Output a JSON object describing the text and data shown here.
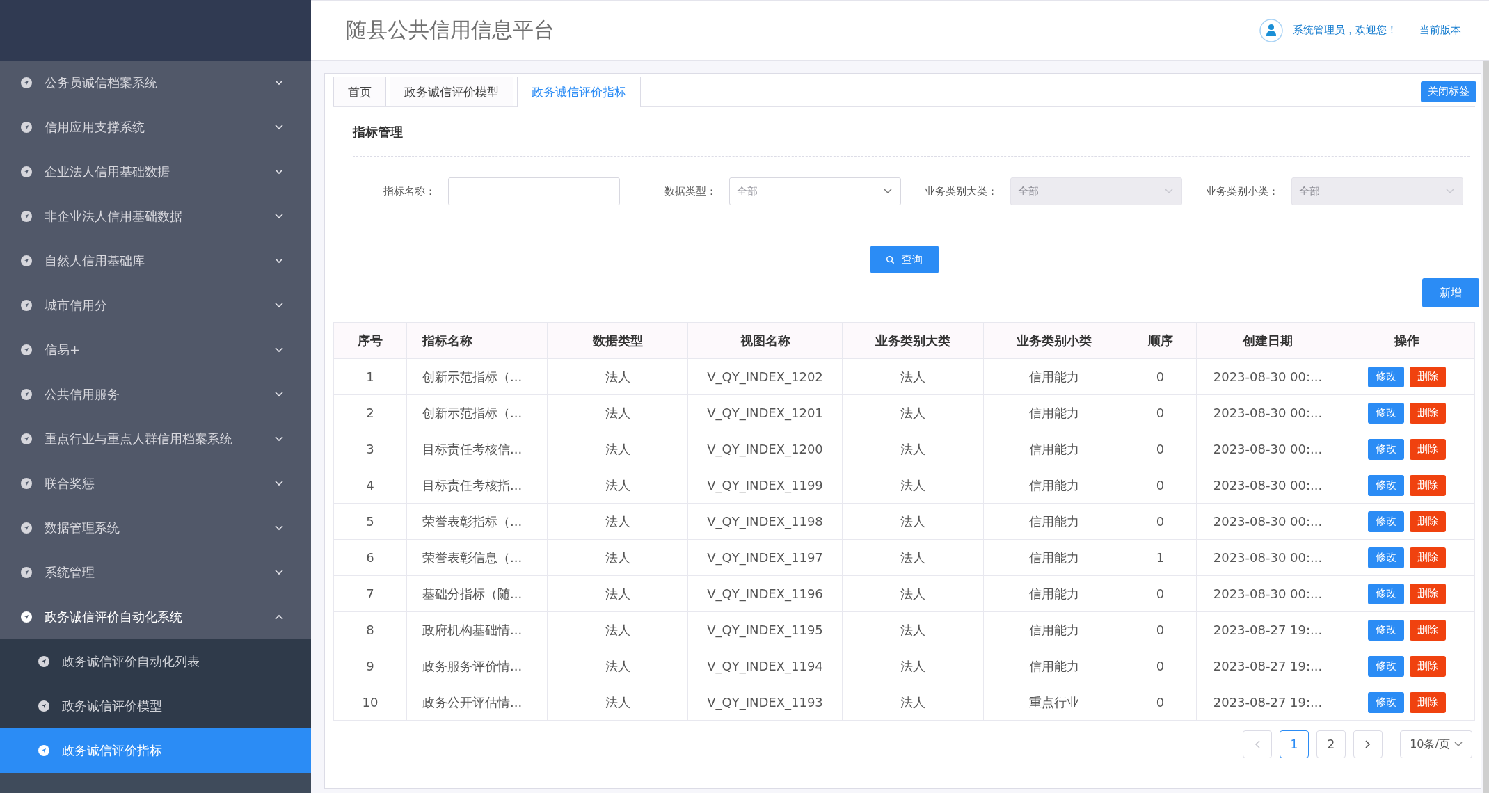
{
  "header": {
    "title": "随县公共信用信息平台",
    "user_greeting": "系统管理员，欢迎您！",
    "version_link": "当前版本"
  },
  "sidebar": {
    "items": [
      {
        "label": "公务员诚信档案系统",
        "expanded": false
      },
      {
        "label": "信用应用支撑系统",
        "expanded": false
      },
      {
        "label": "企业法人信用基础数据",
        "expanded": false
      },
      {
        "label": "非企业法人信用基础数据",
        "expanded": false
      },
      {
        "label": "自然人信用基础库",
        "expanded": false
      },
      {
        "label": "城市信用分",
        "expanded": false
      },
      {
        "label": "信易+",
        "expanded": false
      },
      {
        "label": "公共信用服务",
        "expanded": false
      },
      {
        "label": "重点行业与重点人群信用档案系统",
        "expanded": false
      },
      {
        "label": "联合奖惩",
        "expanded": false
      },
      {
        "label": "数据管理系统",
        "expanded": false
      },
      {
        "label": "系统管理",
        "expanded": false
      },
      {
        "label": "政务诚信评价自动化系统",
        "expanded": true,
        "children": [
          {
            "label": "政务诚信评价自动化列表",
            "selected": false
          },
          {
            "label": "政务诚信评价模型",
            "selected": false
          },
          {
            "label": "政务诚信评价指标",
            "selected": true
          }
        ]
      }
    ]
  },
  "tabs": [
    {
      "label": "首页",
      "selected": false
    },
    {
      "label": "政务诚信评价模型",
      "selected": false
    },
    {
      "label": "政务诚信评价指标",
      "selected": true
    }
  ],
  "close_tabs_button": "关闭标签",
  "section_title": "指标管理",
  "filters": [
    {
      "label": "指标名称：",
      "kind": "input",
      "disabled": false
    },
    {
      "label": "数据类型：",
      "kind": "select",
      "placeholder": "全部",
      "disabled": false
    },
    {
      "label": "业务类别大类：",
      "kind": "select",
      "placeholder": "全部",
      "disabled": true
    },
    {
      "label": "业务类别小类：",
      "kind": "select",
      "placeholder": "全部",
      "disabled": true
    }
  ],
  "query_button": "查询",
  "add_button": "新增",
  "table": {
    "columns": [
      "序号",
      "指标名称",
      "数据类型",
      "视图名称",
      "业务类别大类",
      "业务类别小类",
      "顺序",
      "创建日期",
      "操作"
    ],
    "rows": [
      {
        "cells": [
          "1",
          "创新示范指标（...",
          "法人",
          "V_QY_INDEX_1202",
          "法人",
          "信用能力",
          "0",
          "2023-08-30 00:..."
        ],
        "actions": [
          {
            "label": "修改",
            "kind": "edit"
          },
          {
            "label": "删除",
            "kind": "delete"
          }
        ]
      },
      {
        "cells": [
          "2",
          "创新示范指标（...",
          "法人",
          "V_QY_INDEX_1201",
          "法人",
          "信用能力",
          "0",
          "2023-08-30 00:..."
        ],
        "actions": [
          {
            "label": "修改",
            "kind": "edit"
          },
          {
            "label": "删除",
            "kind": "delete"
          }
        ]
      },
      {
        "cells": [
          "3",
          "目标责任考核信...",
          "法人",
          "V_QY_INDEX_1200",
          "法人",
          "信用能力",
          "0",
          "2023-08-30 00:..."
        ],
        "actions": [
          {
            "label": "修改",
            "kind": "edit"
          },
          {
            "label": "删除",
            "kind": "delete"
          }
        ]
      },
      {
        "cells": [
          "4",
          "目标责任考核指...",
          "法人",
          "V_QY_INDEX_1199",
          "法人",
          "信用能力",
          "0",
          "2023-08-30 00:..."
        ],
        "actions": [
          {
            "label": "修改",
            "kind": "edit"
          },
          {
            "label": "删除",
            "kind": "delete"
          }
        ]
      },
      {
        "cells": [
          "5",
          "荣誉表彰指标（...",
          "法人",
          "V_QY_INDEX_1198",
          "法人",
          "信用能力",
          "0",
          "2023-08-30 00:..."
        ],
        "actions": [
          {
            "label": "修改",
            "kind": "edit"
          },
          {
            "label": "删除",
            "kind": "delete"
          }
        ]
      },
      {
        "cells": [
          "6",
          "荣誉表彰信息（...",
          "法人",
          "V_QY_INDEX_1197",
          "法人",
          "信用能力",
          "1",
          "2023-08-30 00:..."
        ],
        "actions": [
          {
            "label": "修改",
            "kind": "edit"
          },
          {
            "label": "删除",
            "kind": "delete"
          }
        ]
      },
      {
        "cells": [
          "7",
          "基础分指标（随...",
          "法人",
          "V_QY_INDEX_1196",
          "法人",
          "信用能力",
          "0",
          "2023-08-30 00:..."
        ],
        "actions": [
          {
            "label": "修改",
            "kind": "edit"
          },
          {
            "label": "删除",
            "kind": "delete"
          }
        ]
      },
      {
        "cells": [
          "8",
          "政府机构基础情...",
          "法人",
          "V_QY_INDEX_1195",
          "法人",
          "信用能力",
          "0",
          "2023-08-27 19:..."
        ],
        "actions": [
          {
            "label": "修改",
            "kind": "edit"
          },
          {
            "label": "删除",
            "kind": "delete"
          }
        ]
      },
      {
        "cells": [
          "9",
          "政务服务评价情...",
          "法人",
          "V_QY_INDEX_1194",
          "法人",
          "信用能力",
          "0",
          "2023-08-27 19:..."
        ],
        "actions": [
          {
            "label": "修改",
            "kind": "edit"
          },
          {
            "label": "删除",
            "kind": "delete"
          }
        ]
      },
      {
        "cells": [
          "10",
          "政务公开评估情...",
          "法人",
          "V_QY_INDEX_1193",
          "法人",
          "重点行业",
          "0",
          "2023-08-27 19:..."
        ],
        "actions": [
          {
            "label": "修改",
            "kind": "edit"
          },
          {
            "label": "删除",
            "kind": "delete"
          }
        ]
      }
    ]
  },
  "pagination": {
    "prev_disabled": true,
    "pages": [
      {
        "label": "1",
        "selected": true
      },
      {
        "label": "2",
        "selected": false
      }
    ],
    "next_disabled": false,
    "page_size": "10条/页"
  }
}
